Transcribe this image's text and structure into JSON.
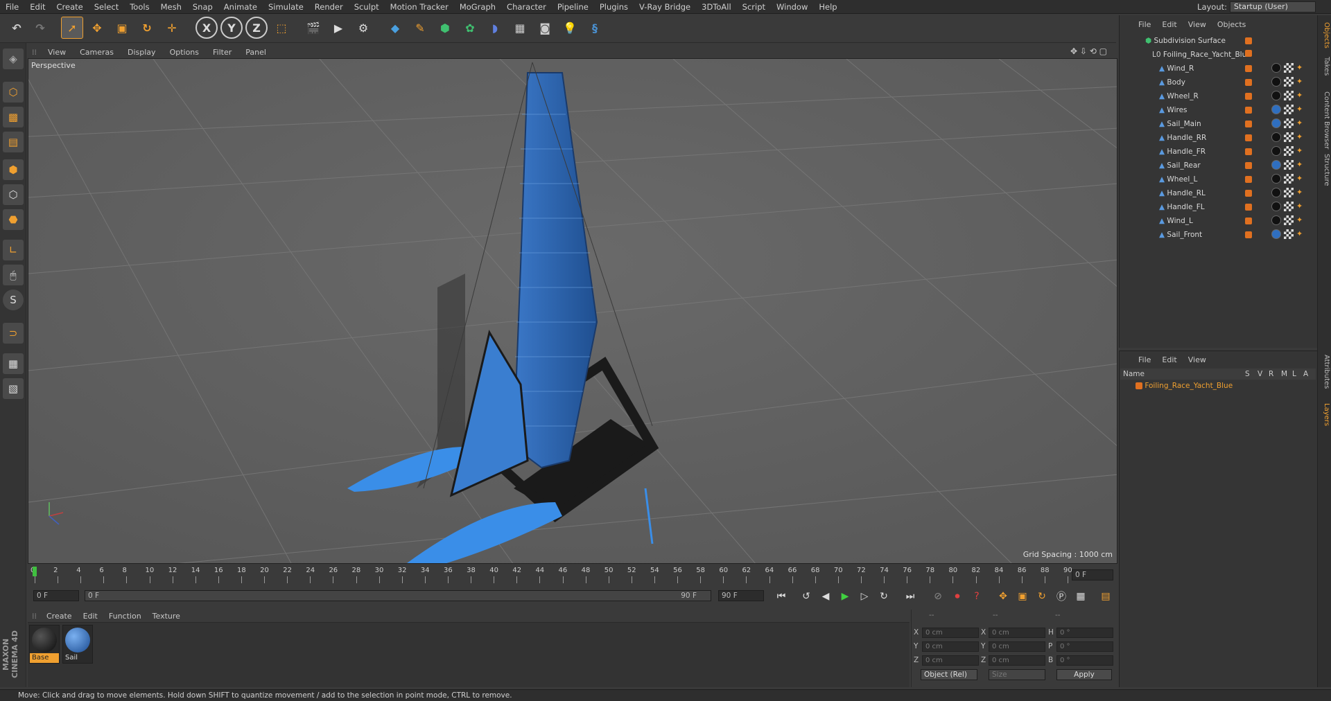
{
  "menu": [
    "File",
    "Edit",
    "Create",
    "Select",
    "Tools",
    "Mesh",
    "Snap",
    "Animate",
    "Simulate",
    "Render",
    "Sculpt",
    "Motion Tracker",
    "MoGraph",
    "Character",
    "Pipeline",
    "Plugins",
    "V-Ray Bridge",
    "3DToAll",
    "Script",
    "Window",
    "Help"
  ],
  "layout": {
    "label": "Layout:",
    "value": "Startup (User)"
  },
  "viewport": {
    "menu": [
      "View",
      "Cameras",
      "Display",
      "Options",
      "Filter",
      "Panel"
    ],
    "camera_label": "Perspective",
    "grid_spacing": "Grid Spacing : 1000 cm"
  },
  "timeline": {
    "ticks": [
      "0",
      "2",
      "4",
      "6",
      "8",
      "10",
      "12",
      "14",
      "16",
      "18",
      "20",
      "22",
      "24",
      "26",
      "28",
      "30",
      "32",
      "34",
      "36",
      "38",
      "40",
      "42",
      "44",
      "46",
      "48",
      "50",
      "52",
      "54",
      "56",
      "58",
      "60",
      "62",
      "64",
      "66",
      "68",
      "70",
      "72",
      "74",
      "76",
      "78",
      "80",
      "82",
      "84",
      "86",
      "88",
      "90"
    ],
    "current_frame": "0 F",
    "start_frame": "0 F",
    "range_start": "0 F",
    "range_end": "90 F",
    "end_frame": "90 F"
  },
  "materials": {
    "menu": [
      "Create",
      "Edit",
      "Function",
      "Texture"
    ],
    "items": [
      {
        "name": "Base",
        "color": "#1a1a1a"
      },
      {
        "name": "Sail",
        "color": "#2f6fc0"
      }
    ]
  },
  "coords": {
    "header": [
      "--",
      "--",
      "--"
    ],
    "rows": [
      {
        "a": "X",
        "av": "0 cm",
        "b": "X",
        "bv": "0 cm",
        "c": "H",
        "cv": "0 °"
      },
      {
        "a": "Y",
        "av": "0 cm",
        "b": "Y",
        "bv": "0 cm",
        "c": "P",
        "cv": "0 °"
      },
      {
        "a": "Z",
        "av": "0 cm",
        "b": "Z",
        "bv": "0 cm",
        "c": "B",
        "cv": "0 °"
      }
    ],
    "mode": "Object (Rel)",
    "size": "Size",
    "apply": "Apply"
  },
  "object_manager": {
    "menu": [
      "File",
      "Edit",
      "View",
      "Objects"
    ],
    "root": "Subdivision Surface",
    "group": "Foiling_Race_Yacht_Blue",
    "children": [
      "Wind_R",
      "Body",
      "Wheel_R",
      "Wires",
      "Sail_Main",
      "Handle_RR",
      "Handle_FR",
      "Sail_Rear",
      "Wheel_L",
      "Handle_RL",
      "Handle_FL",
      "Wind_L",
      "Sail_Front"
    ],
    "child_material": [
      "dark",
      "dark",
      "dark",
      "blue",
      "blue",
      "dark",
      "dark",
      "blue",
      "dark",
      "dark",
      "dark",
      "dark",
      "blue"
    ]
  },
  "layer_manager": {
    "menu": [
      "File",
      "Edit",
      "View"
    ],
    "columns": [
      "Name",
      "S",
      "V",
      "R",
      "M",
      "L",
      "A"
    ],
    "layer": "Foiling_Race_Yacht_Blue"
  },
  "right_tabs": [
    "Objects",
    "Takes",
    "Content Browser",
    "Structure",
    "Attributes",
    "Layers"
  ],
  "status": "Move: Click and drag to move elements. Hold down SHIFT to quantize movement / add to the selection in point mode, CTRL to remove.",
  "colors": {
    "accent": "#f0a030",
    "layer": "#e07020",
    "timeline_marker": "#40c040"
  }
}
